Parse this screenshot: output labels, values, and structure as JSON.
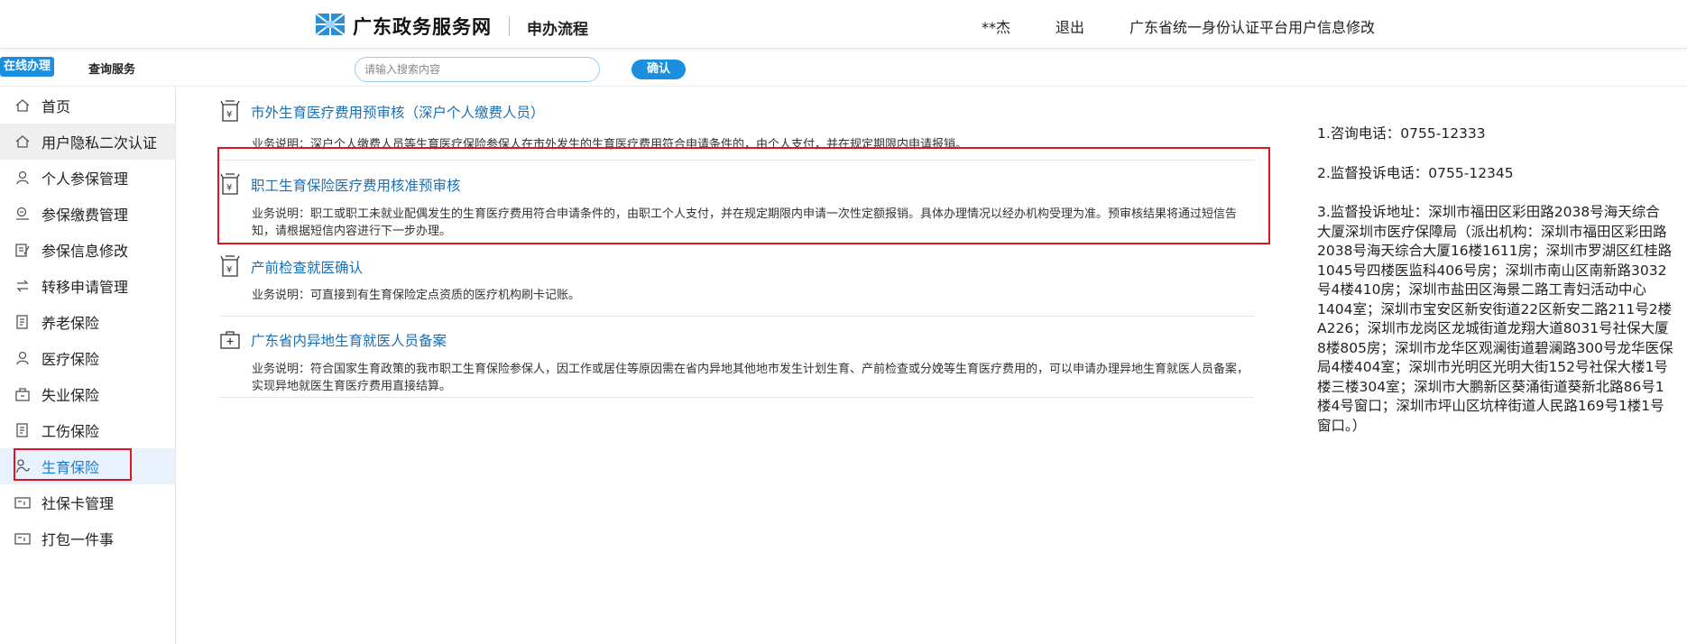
{
  "header": {
    "site_name": "广东政务服务网",
    "subtitle": "申办流程",
    "user": "**杰",
    "logout": "退出",
    "profile_link": "广东省统一身份认证平台用户信息修改"
  },
  "subbar": {
    "tab_online": "在线办理",
    "tab_query": "查询服务",
    "search_placeholder": "请输入搜索内容",
    "confirm": "确认"
  },
  "sidebar": {
    "items": [
      {
        "label": "首页",
        "icon": "home-icon"
      },
      {
        "label": "用户隐私二次认证",
        "icon": "home-icon"
      },
      {
        "label": "个人参保管理",
        "icon": "person-icon"
      },
      {
        "label": "参保缴费管理",
        "icon": "payment-icon"
      },
      {
        "label": "参保信息修改",
        "icon": "edit-icon"
      },
      {
        "label": "转移申请管理",
        "icon": "transfer-icon"
      },
      {
        "label": "养老保险",
        "icon": "document-icon"
      },
      {
        "label": "医疗保险",
        "icon": "person-icon"
      },
      {
        "label": "失业保险",
        "icon": "briefcase-icon"
      },
      {
        "label": "工伤保险",
        "icon": "document-icon"
      },
      {
        "label": "生育保险",
        "icon": "maternity-icon"
      },
      {
        "label": "社保卡管理",
        "icon": "card-icon"
      },
      {
        "label": "打包一件事",
        "icon": "card-icon"
      }
    ],
    "active_index": 10
  },
  "services": [
    {
      "title": "市外生育医疗费用预审核（深户个人缴费人员）",
      "desc": "业务说明：深户个人缴费人员等生育医疗保险参保人在市外发生的生育医疗费用符合申请条件的，由个人支付，并在规定期限内申请报销。",
      "icon": "yuan-bag-icon"
    },
    {
      "title": "职工生育保险医疗费用核准预审核",
      "desc": "业务说明：职工或职工未就业配偶发生的生育医疗费用符合申请条件的，由职工个人支付，并在规定期限内申请一次性定额报销。具体办理情况以经办机构受理为准。预审核结果将通过短信告知，请根据短信内容进行下一步办理。",
      "icon": "yuan-bag-icon"
    },
    {
      "title": "产前检查就医确认",
      "desc": "业务说明：可直接到有生育保险定点资质的医疗机构刷卡记账。",
      "icon": "yuan-bag-icon"
    },
    {
      "title": "广东省内异地生育就医人员备案",
      "desc": "业务说明：符合国家生育政策的我市职工生育保险参保人，因工作或居住等原因需在省内异地其他地市发生计划生育、产前检查或分娩等生育医疗费用的，可以申请办理异地生育就医人员备案，实现异地就医生育医疗费用直接结算。",
      "icon": "medical-kit-icon"
    }
  ],
  "info": {
    "consult": "1.咨询电话：0755-12333",
    "complaint_phone": "2.监督投诉电话：0755-12345",
    "complaint_address": "3.监督投诉地址：深圳市福田区彩田路2038号海天综合大厦深圳市医疗保障局（派出机构：深圳市福田区彩田路2038号海天综合大厦16楼1611房；深圳市罗湖区红桂路1045号四楼医监科406号房；深圳市南山区南新路3032号4楼410房；深圳市盐田区海景二路工青妇活动中心1404室；深圳市宝安区新安街道22区新安二路211号2楼A226；深圳市龙岗区龙城街道龙翔大道8031号社保大厦8楼805房；深圳市龙华区观澜街道碧澜路300号龙华医保局4楼404室；深圳市光明区光明大街152号社保大楼1号楼三楼304室；深圳市大鹏新区葵涌街道葵新北路86号1楼4号窗口；深圳市坪山区坑梓街道人民路169号1楼1号窗口。）"
  },
  "colors": {
    "accent": "#1a8fe0",
    "link": "#1a6fb5",
    "highlight": "#e0141e"
  }
}
